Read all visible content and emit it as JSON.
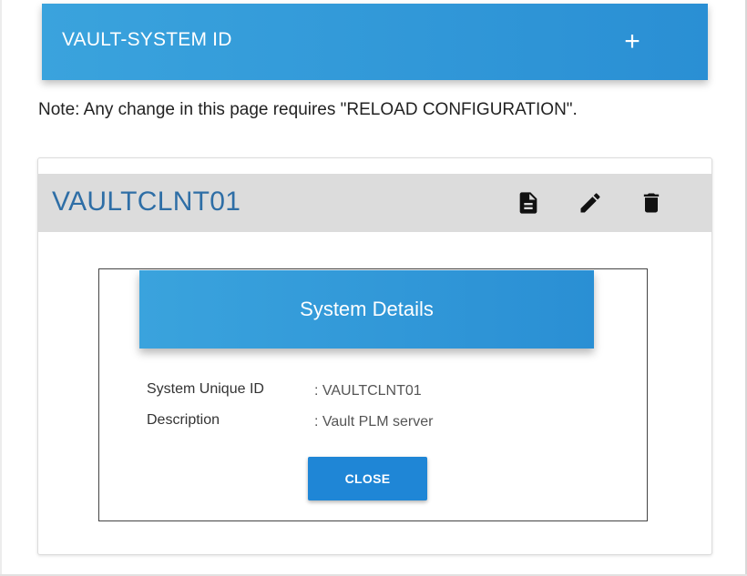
{
  "header": {
    "title": "VAULT-SYSTEM ID",
    "add_symbol": "+"
  },
  "note": "Note: Any change in this page requires \"RELOAD CONFIGURATION\".",
  "system_card": {
    "title": "VAULTCLNT01",
    "actions": [
      {
        "icon": "document-icon"
      },
      {
        "icon": "edit-pencil-icon"
      },
      {
        "icon": "trash-icon"
      }
    ]
  },
  "dialog": {
    "title": "System Details",
    "fields": [
      {
        "label": "System Unique ID",
        "value": ": VAULTCLNT01"
      },
      {
        "label": "Description",
        "value": ": Vault PLM server"
      }
    ],
    "close_label": "CLOSE"
  },
  "colors": {
    "accent_blue": "#2a8fd4",
    "title_blue": "#2e6ea6",
    "card_header_gray": "#dcdcdc"
  }
}
